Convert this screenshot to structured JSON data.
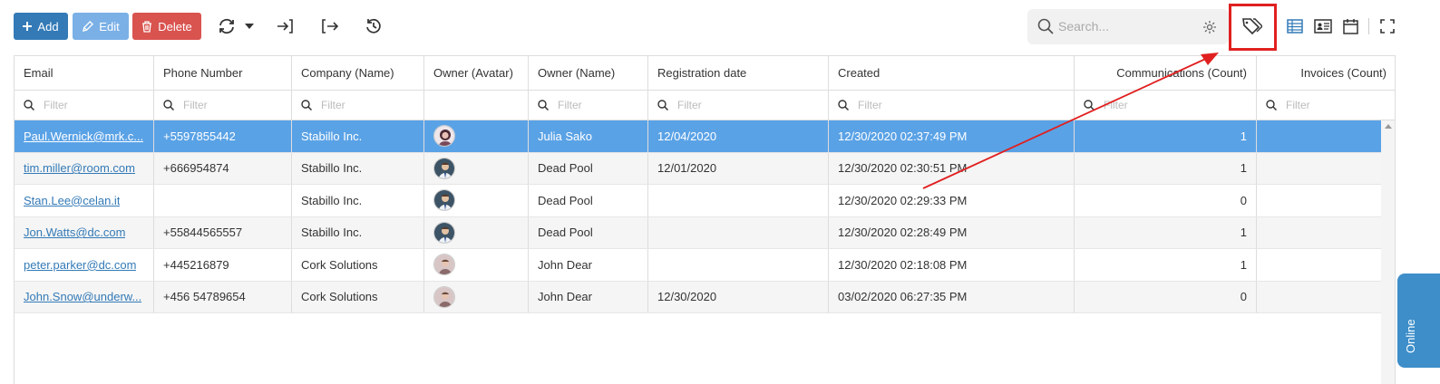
{
  "toolbar": {
    "add_label": "Add",
    "edit_label": "Edit",
    "delete_label": "Delete",
    "icons": [
      "plus-icon",
      "pencil-icon",
      "trash-icon",
      "refresh-icon",
      "caret-down-icon",
      "import-icon",
      "export-icon",
      "history-icon",
      "search-icon",
      "gear-icon",
      "tag-icon",
      "table-view-icon",
      "card-view-icon",
      "calendar-view-icon",
      "fullscreen-icon"
    ]
  },
  "search": {
    "placeholder": "Search..."
  },
  "colors": {
    "add": "#337ab7",
    "edit": "#7ab0e6",
    "delete": "#d9534f",
    "selected_row": "#5aa2e6",
    "highlight": "#e02020",
    "online_tab": "#3d8ec9"
  },
  "grid": {
    "columns": [
      {
        "label": "Email",
        "filter": "Filter"
      },
      {
        "label": "Phone Number",
        "filter": "Filter"
      },
      {
        "label": "Company (Name)",
        "filter": "Filter"
      },
      {
        "label": "Owner (Avatar)",
        "filter": ""
      },
      {
        "label": "Owner (Name)",
        "filter": "Filter"
      },
      {
        "label": "Registration date",
        "filter": "Filter"
      },
      {
        "label": "Created",
        "filter": "Filter"
      },
      {
        "label": "Communications (Count)",
        "filter": "Filter"
      },
      {
        "label": "Invoices (Count)",
        "filter": "Filter"
      }
    ],
    "rows": [
      {
        "email": "Paul.Wernick@mrk.c...",
        "phone": "+5597855442",
        "company": "Stabillo Inc.",
        "avatar": "female",
        "owner": "Julia Sako",
        "registration": "12/04/2020",
        "created": "12/30/2020 02:37:49 PM",
        "communications": "1",
        "invoices": ""
      },
      {
        "email": "tim.miller@room.com",
        "phone": "+666954874",
        "company": "Stabillo Inc.",
        "avatar": "male-1",
        "owner": "Dead Pool",
        "registration": "12/01/2020",
        "created": "12/30/2020 02:30:51 PM",
        "communications": "1",
        "invoices": ""
      },
      {
        "email": "Stan.Lee@celan.it",
        "phone": "",
        "company": "Stabillo Inc.",
        "avatar": "male-1",
        "owner": "Dead Pool",
        "registration": "",
        "created": "12/30/2020 02:29:33 PM",
        "communications": "0",
        "invoices": ""
      },
      {
        "email": "Jon.Watts@dc.com",
        "phone": "+55844565557",
        "company": "Stabillo Inc.",
        "avatar": "male-1",
        "owner": "Dead Pool",
        "registration": "",
        "created": "12/30/2020 02:28:49 PM",
        "communications": "1",
        "invoices": ""
      },
      {
        "email": "peter.parker@dc.com",
        "phone": "+445216879",
        "company": "Cork Solutions",
        "avatar": "male-2",
        "owner": "John Dear",
        "registration": "",
        "created": "12/30/2020 02:18:08 PM",
        "communications": "1",
        "invoices": ""
      },
      {
        "email": "John.Snow@underw...",
        "phone": "+456 54789654",
        "company": "Cork Solutions",
        "avatar": "male-2",
        "owner": "John Dear",
        "registration": "12/30/2020",
        "created": "03/02/2020 06:27:35 PM",
        "communications": "0",
        "invoices": ""
      }
    ],
    "selected_row": 0
  },
  "online_tab": {
    "label": "Online"
  }
}
